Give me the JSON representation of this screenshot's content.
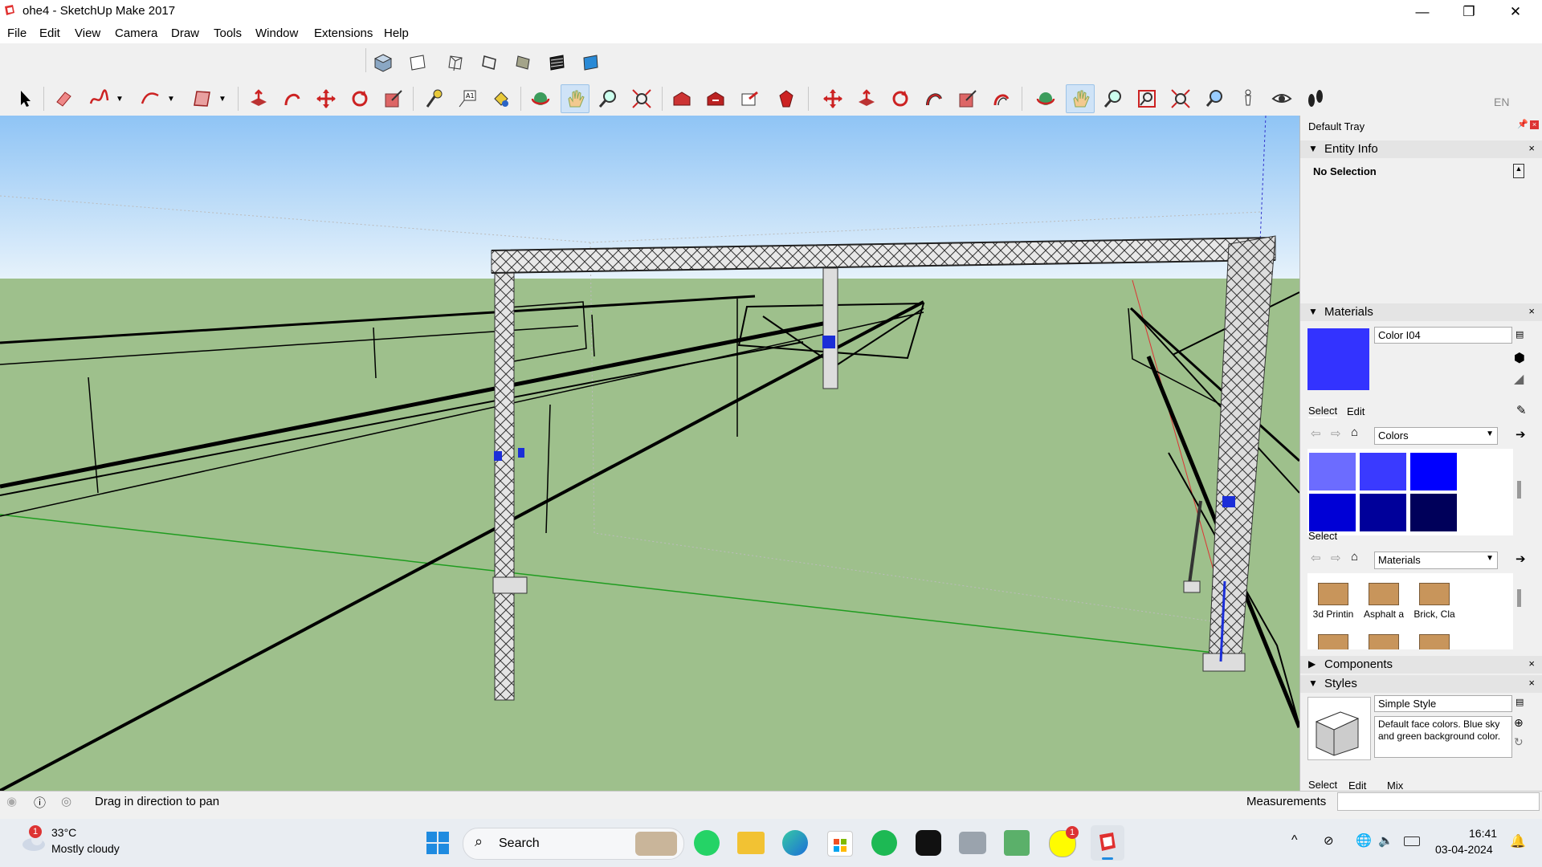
{
  "window": {
    "title": "ohe4 - SketchUp Make 2017",
    "minimize_glyph": "—",
    "maximize_glyph": "❐",
    "close_glyph": "✕"
  },
  "menu": [
    "File",
    "Edit",
    "View",
    "Camera",
    "Draw",
    "Tools",
    "Window",
    "Extensions",
    "Help"
  ],
  "toolbar_language": "EN",
  "tray": {
    "title": "Default Tray",
    "entity_info": {
      "header": "Entity Info",
      "selection": "No Selection"
    },
    "materials": {
      "header": "Materials",
      "current_name": "Color I04",
      "current_color": "#3333ff",
      "tabs": [
        "Select",
        "Edit"
      ],
      "collection": "Colors",
      "swatches": [
        "#6c6cff",
        "#3a3aff",
        "#0000ff",
        "#0000d6",
        "#00009a",
        "#00005a"
      ],
      "secondary_label": "Select",
      "secondary_collection": "Materials",
      "material_items": [
        "3d Printin",
        "Asphalt a",
        "Brick, Cla"
      ]
    },
    "components": {
      "header": "Components"
    },
    "styles": {
      "header": "Styles",
      "style_name": "Simple Style",
      "description": "Default face colors. Blue sky and green background color.",
      "tabs": [
        "Select",
        "Edit",
        "Mix"
      ]
    }
  },
  "status": {
    "message": "Drag in direction to pan",
    "measurements_label": "Measurements",
    "measurements_value": ""
  },
  "taskbar": {
    "weather_temp": "33°C",
    "weather_desc": "Mostly cloudy",
    "weather_badge": "1",
    "search_label": "Search",
    "time": "16:41",
    "date": "03-04-2024",
    "snapchat_badge": "1"
  },
  "colors": {
    "sky_top": "#8fc4f5",
    "sky_bottom": "#e6f2fb",
    "ground": "#9ec08c",
    "selection_blue": "#cfe3f7"
  }
}
